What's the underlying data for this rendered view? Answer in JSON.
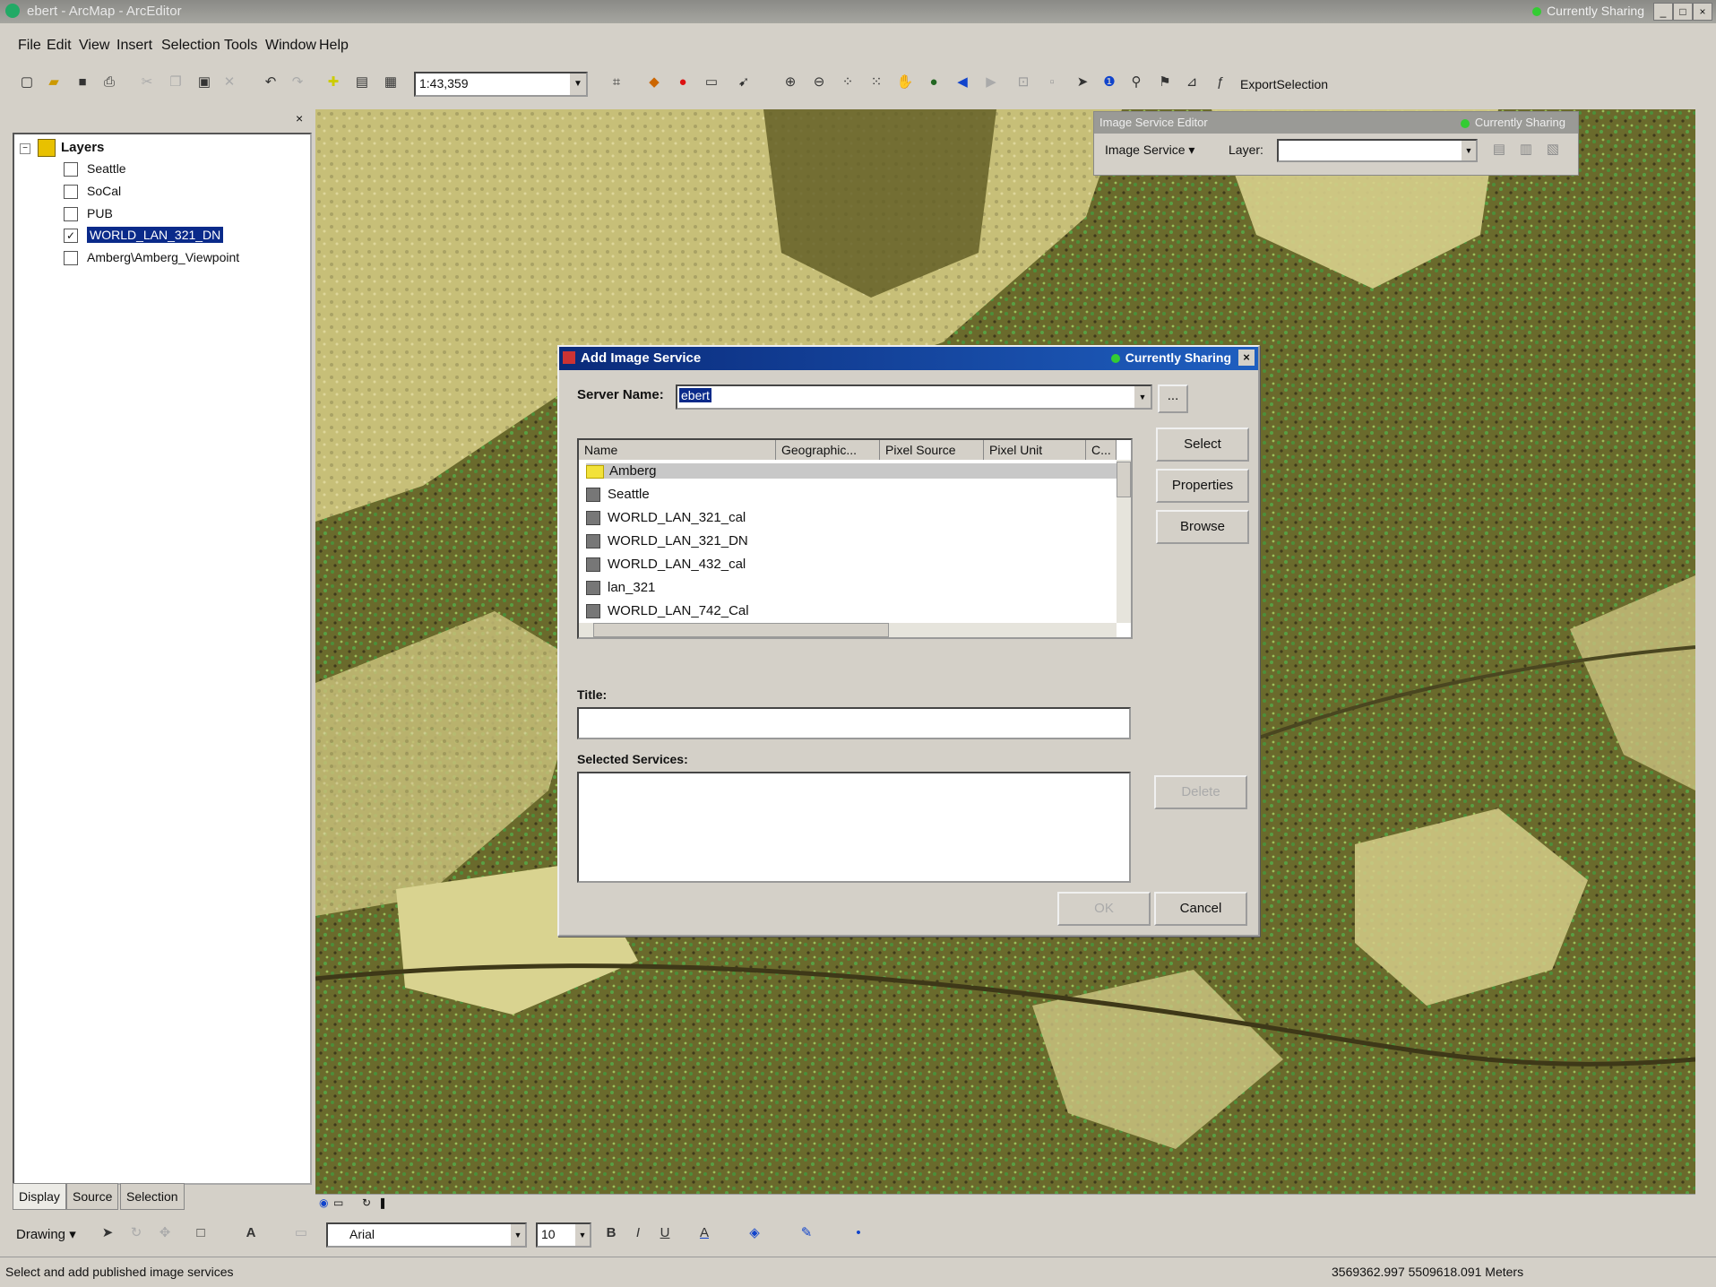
{
  "window": {
    "title": "ebert - ArcMap - ArcEditor",
    "sharing_status": "Currently Sharing"
  },
  "menu": [
    "File",
    "Edit",
    "View",
    "Insert",
    "Selection",
    "Tools",
    "Window",
    "Help"
  ],
  "toolbar": {
    "scale": "1:43,359",
    "export_label": "ExportSelection"
  },
  "toc": {
    "root": "Layers",
    "layers": [
      {
        "label": "Seattle",
        "checked": false
      },
      {
        "label": "SoCal",
        "checked": false
      },
      {
        "label": "PUB",
        "checked": false
      },
      {
        "label": "WORLD_LAN_321_DN",
        "checked": true
      },
      {
        "label": "Amberg\\Amberg_Viewpoint",
        "checked": false
      }
    ],
    "tabs": [
      "Display",
      "Source",
      "Selection"
    ]
  },
  "image_service_editor": {
    "title": "Image Service Editor",
    "sharing_status": "Currently Sharing",
    "menu_label": "Image Service",
    "layer_label": "Layer:"
  },
  "dialog": {
    "title": "Add Image Service",
    "sharing_status": "Currently Sharing",
    "server_name_label": "Server Name:",
    "server_name_value": "ebert",
    "browse_label": "...",
    "columns": [
      "Name",
      "Geographic...",
      "Pixel Source",
      "Pixel Unit",
      "C..."
    ],
    "services": [
      {
        "name": "Amberg",
        "type": "folder"
      },
      {
        "name": "Seattle",
        "type": "service"
      },
      {
        "name": "WORLD_LAN_321_cal",
        "type": "service"
      },
      {
        "name": "WORLD_LAN_321_DN",
        "type": "service"
      },
      {
        "name": "WORLD_LAN_432_cal",
        "type": "service"
      },
      {
        "name": "lan_321",
        "type": "service"
      },
      {
        "name": "WORLD_LAN_742_Cal",
        "type": "service"
      }
    ],
    "buttons": {
      "select": "Select",
      "properties": "Properties",
      "browse": "Browse",
      "delete": "Delete",
      "ok": "OK",
      "cancel": "Cancel"
    },
    "title_label": "Title:",
    "title_value": "",
    "selected_label": "Selected Services:"
  },
  "drawing": {
    "label": "Drawing",
    "font": "Arial",
    "size": "10"
  },
  "status": {
    "message": "Select and add published image services",
    "coords": "3569362.997 5509618.091 Meters"
  }
}
